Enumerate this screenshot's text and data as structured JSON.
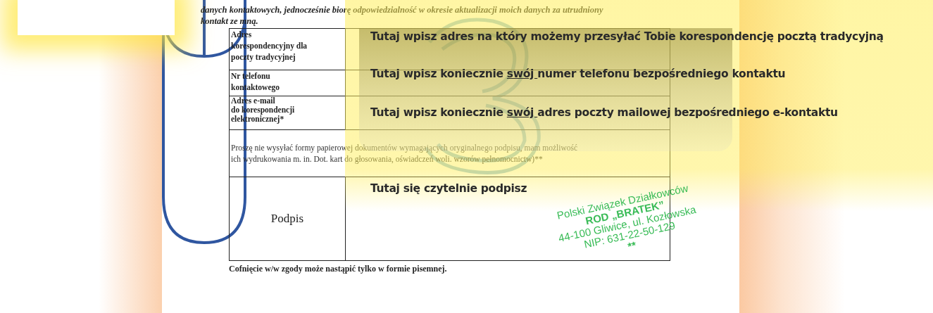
{
  "intro": {
    "lines": [
      "danych kontaktowych, jednocześnie biorę odpowiedzialność w okresie aktualizacji moich danych za utrudniony",
      "kontakt ze mną."
    ]
  },
  "form_rows": [
    {
      "kind": "field",
      "label_lines": [
        "Adres",
        "korespondencyjny dla",
        "poczty tradycyjnej"
      ]
    },
    {
      "kind": "field",
      "label_lines": [
        "Nr telefonu",
        "kontaktowego"
      ]
    },
    {
      "kind": "field",
      "label_lines": [
        "Adres e-mail",
        "do korespondencji",
        "elektronicznej*"
      ]
    },
    {
      "kind": "note",
      "label_lines": [
        "Proszę nie wysyłać formy papierowej dokumentów wymagających oryginalnego podpisu, mam możliwość",
        "ich wydrukowania m. in. Dot. kart do głosowania, oświadczeń woli. wzorów pełnomocnictw)**"
      ]
    },
    {
      "kind": "signature",
      "label_lines": [
        "Podpis"
      ]
    }
  ],
  "footer": "Cofnięcie w/w zgody może nastąpić tylko w formie pisemnej.",
  "annotations": [
    {
      "parts": [
        {
          "text": "Tutaj wpisz adres na który możemy przesyłać Tobie korespondencję pocztą tradycyjną",
          "underline": false
        }
      ]
    },
    {
      "parts": [
        {
          "text": "Tutaj wpisz koniecznie ",
          "underline": false
        },
        {
          "text": "swój ",
          "underline": true
        },
        {
          "text": "numer telefonu bezpośredniego kontaktu",
          "underline": false
        }
      ]
    },
    {
      "parts": [
        {
          "text": "Tutaj wpisz koniecznie ",
          "underline": false
        },
        {
          "text": "swój ",
          "underline": true
        },
        {
          "text": "adres poczty mailowej bezpośredniego e-kontaktu",
          "underline": false
        }
      ]
    },
    {
      "parts": [
        {
          "text": "Tutaj się czytelnie podpisz",
          "underline": false
        }
      ]
    }
  ],
  "stamp": {
    "lines": [
      {
        "text": "Polski Związek Działkowców",
        "bold": false
      },
      {
        "text": "ROD „BRATEK”",
        "bold": true
      },
      {
        "text": "44-100 Gliwice, ul. Kozłowska",
        "bold": false
      },
      {
        "text": "NIP: 631-22-50-129",
        "bold": false
      },
      {
        "text": "**",
        "bold": true
      }
    ]
  }
}
